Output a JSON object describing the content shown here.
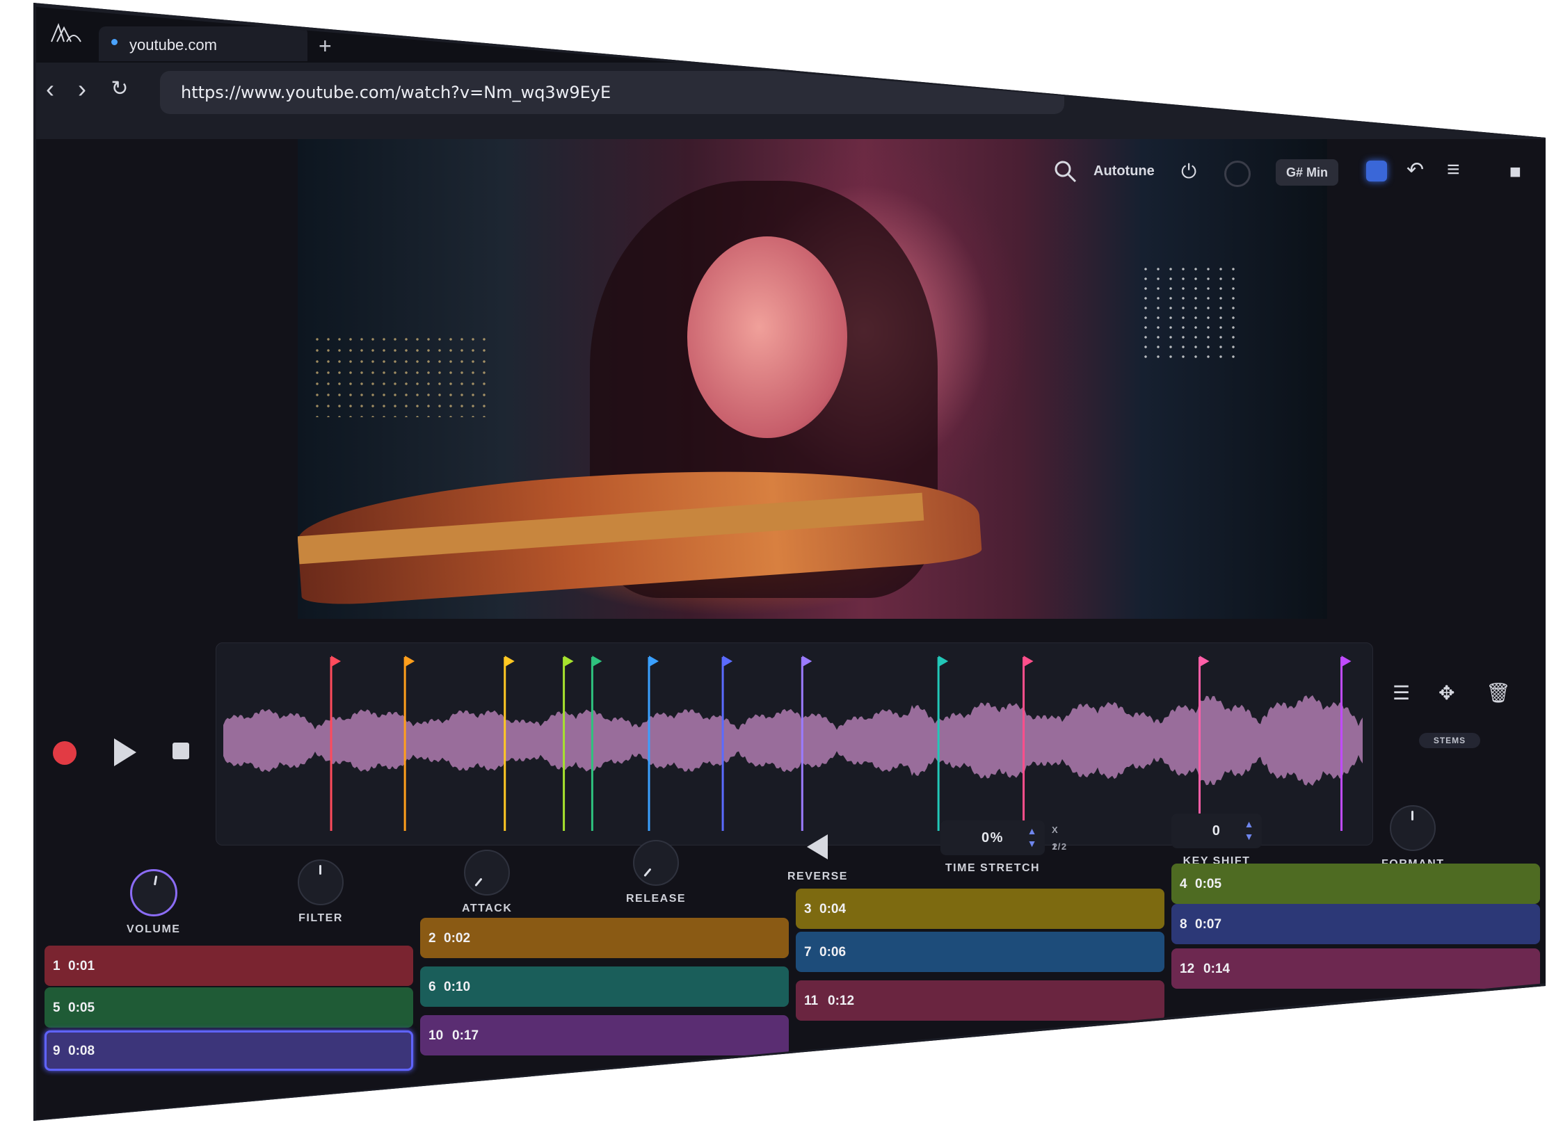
{
  "browser": {
    "tab_title": "youtube.com",
    "new_tab": "+",
    "url": "https://www.youtube.com/watch?v=Nm_wq3w9EyE",
    "nav": {
      "back": "‹",
      "forward": "›",
      "reload": "↻"
    }
  },
  "toolbar": {
    "autotune_label": "Autotune",
    "key": "G# Min"
  },
  "transport": {
    "record": "record",
    "play": "play",
    "stop": "stop"
  },
  "waveform": {
    "stems_label": "STEMS",
    "markers": [
      {
        "pos": 0.095,
        "color": "#ff4b5c"
      },
      {
        "pos": 0.16,
        "color": "#ff9f1c"
      },
      {
        "pos": 0.248,
        "color": "#ffc823"
      },
      {
        "pos": 0.3,
        "color": "#a6e22e"
      },
      {
        "pos": 0.325,
        "color": "#2ec27e"
      },
      {
        "pos": 0.375,
        "color": "#3aa0ff"
      },
      {
        "pos": 0.44,
        "color": "#5b6bff"
      },
      {
        "pos": 0.51,
        "color": "#9b7bff"
      },
      {
        "pos": 0.63,
        "color": "#22c7b8"
      },
      {
        "pos": 0.705,
        "color": "#ff4f8b"
      },
      {
        "pos": 0.86,
        "color": "#ff5fa8"
      },
      {
        "pos": 0.985,
        "color": "#c04bff"
      }
    ]
  },
  "fx": {
    "volume": "VOLUME",
    "filter": "FILTER",
    "attack": "ATTACK",
    "release": "RELEASE",
    "reverse": "REVERSE",
    "time_stretch": {
      "label": "TIME STRETCH",
      "value": "0%",
      "x2": "X 2",
      "half": "1/2"
    },
    "key_shift": {
      "label": "KEY SHIFT",
      "value": "0"
    },
    "formant": "FORMANT"
  },
  "pads": [
    {
      "n": "1",
      "t": "0:01",
      "color": "#7a2430"
    },
    {
      "n": "2",
      "t": "0:02",
      "color": "#8a5a14"
    },
    {
      "n": "3",
      "t": "0:04",
      "color": "#7d6a10"
    },
    {
      "n": "4",
      "t": "0:05",
      "color": "#4e6b22"
    },
    {
      "n": "5",
      "t": "0:05",
      "color": "#1f5b36"
    },
    {
      "n": "6",
      "t": "0:10",
      "color": "#1a5e5a"
    },
    {
      "n": "7",
      "t": "0:06",
      "color": "#1d4c7a"
    },
    {
      "n": "8",
      "t": "0:07",
      "color": "#2c3877"
    },
    {
      "n": "9",
      "t": "0:08",
      "color": "#3c357a"
    },
    {
      "n": "10",
      "t": "0:17",
      "color": "#5a2d72"
    },
    {
      "n": "11",
      "t": "0:12",
      "color": "#6a2540"
    },
    {
      "n": "12",
      "t": "0:14",
      "color": "#6d2850"
    }
  ]
}
